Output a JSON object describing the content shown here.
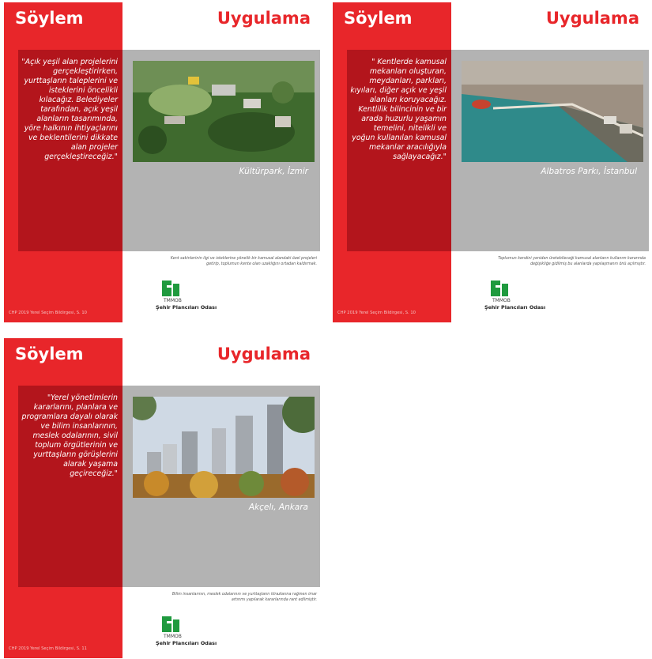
{
  "colors": {
    "red": "#e8262a",
    "dark_red": "#b3151c",
    "gray": "#b3b3b3",
    "logo_green": "#1f9a3e"
  },
  "cards": [
    {
      "left_title": "Söylem",
      "right_title": "Uygulama",
      "quote": "\"Açık yeşil alan projelerini gerçekleştirirken, yurttaşların taleplerini ve isteklerini öncelikli kılacağız. Belediyeler tarafından, açık yeşil alanların tasarımında, yöre halkının ihtiyaçlarını ve beklentilerini dikkate alan projeler gerçekleştireceğiz.\"",
      "photo_caption": "Kültürpark, İzmir",
      "note": "Kent sakinlerinin ilgi ve isteklerine yönelik bir kamusal alandaki özel projeleri getirip, toplumun kente olan uzaklığını ortadan kaldırmak.",
      "logo_org": "TMMOB",
      "logo_name": "Şehir Plancıları Odası",
      "footer": "CHP 2019 Yerel Seçim Bildirgesi, S. 10",
      "photo_icon": "park-aerial-photo"
    },
    {
      "left_title": "Söylem",
      "right_title": "Uygulama",
      "quote": "\" Kentlerde kamusal mekanları oluşturan, meydanları, parkları, kıyıları, diğer açık ve yeşil alanları koruyacağız. Kentlilik bilincinin ve bir arada huzurlu yaşamın temelini, nitelikli ve yoğun kullanılan kamusal mekanlar aracılığıyla sağlayacağız.\"",
      "photo_caption": "Albatros Parkı, İstanbul",
      "note": "Toplumun kendini yeniden üretebileceği kamusal alanların kullanım kararında değişikliğe gidilmiş bu alanlarda yapılaşmanın önü açılmıştır.",
      "logo_org": "TMMOB",
      "logo_name": "Şehir Plancıları Odası",
      "footer": "CHP 2019 Yerel Seçim Bildirgesi, S. 10",
      "photo_icon": "coastal-park-photo"
    },
    {
      "left_title": "Söylem",
      "right_title": "Uygulama",
      "quote": "\"Yerel yönetimlerin kararlarını, planlara ve programlara dayalı olarak ve bilim insanlarının, meslek odalarının, sivil toplum örgütlerinin ve yurttaşların görüşlerini alarak yaşama geçireceğiz.\"",
      "photo_caption": "Akçelı, Ankara",
      "note": "Bilim insanlarının, meslek odalarının ve yurttaşların itirazlarına rağmen imar artırımı yapılarak kararlarında rant edilmiştir.",
      "logo_org": "TMMOB",
      "logo_name": "Şehir Plancıları Odası",
      "footer": "CHP 2019 Yerel Seçim Bildirgesi, S. 11",
      "photo_icon": "high-rise-towers-photo"
    }
  ]
}
